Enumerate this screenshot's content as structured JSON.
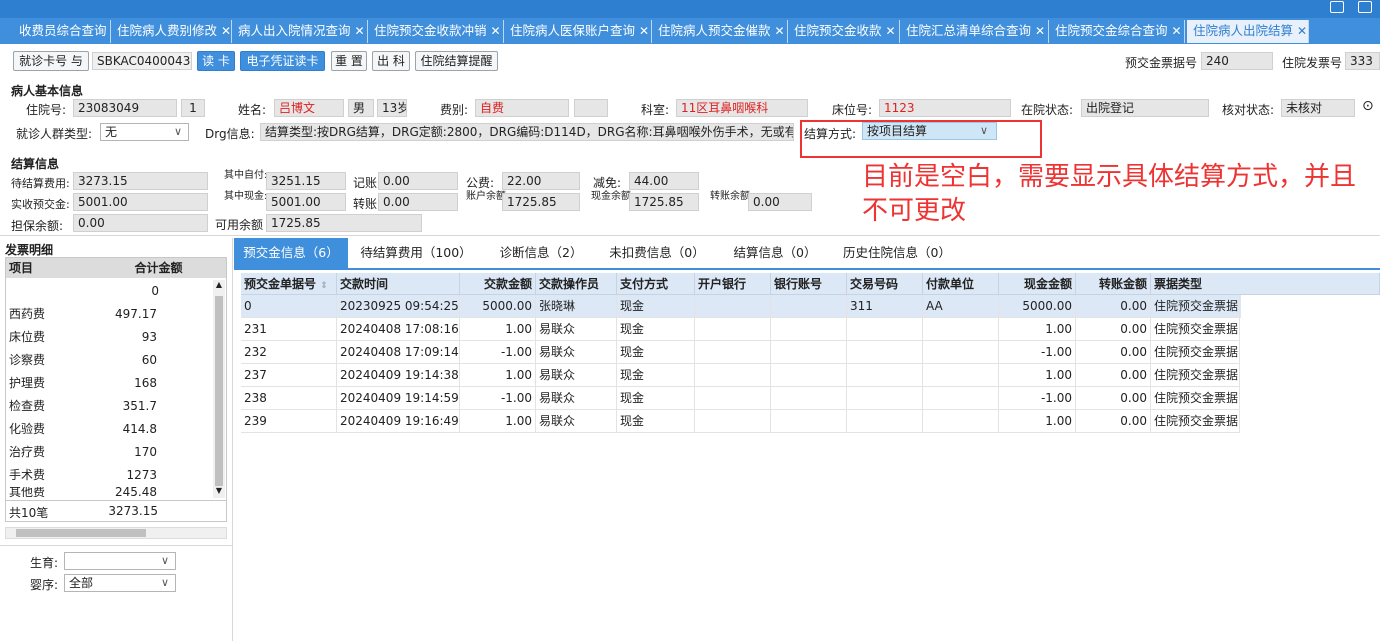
{
  "tabs": [
    {
      "label": "收费员综合查询"
    },
    {
      "label": "住院病人费别修改"
    },
    {
      "label": "病人出入院情况查询"
    },
    {
      "label": "住院预交金收款冲销"
    },
    {
      "label": "住院病人医保账户查询"
    },
    {
      "label": "住院病人预交金催款"
    },
    {
      "label": "住院预交金收款"
    },
    {
      "label": "住院汇总清单综合查询"
    },
    {
      "label": "住院预交金综合查询"
    },
    {
      "label": "住院病人出院结算"
    }
  ],
  "toolbar": {
    "visit_type": "就诊卡号",
    "visit_type_suffix": "与",
    "card_no": "SBKAC0400043",
    "read_card": "读 卡",
    "e_voucher": "电子凭证读卡",
    "reset": "重 置",
    "discharge": "出 科",
    "reminder": "住院结算提醒",
    "deposit_invoice_label": "预交金票据号",
    "deposit_invoice": "240",
    "invoice_label": "住院发票号",
    "invoice": "333"
  },
  "patient": {
    "section_title": "病人基本信息",
    "inpatient_no_label": "住院号:",
    "inpatient_no": "23083049",
    "times": "1",
    "name_label": "姓名:",
    "name": "吕博文",
    "gender": "男",
    "age": "13岁",
    "fee_type_label": "费别:",
    "fee_type": "自费",
    "dept_label": "科室:",
    "dept": "11区耳鼻咽喉科",
    "bed_label": "床位号:",
    "bed": "1123",
    "status_label": "在院状态:",
    "status": "出院登记",
    "check_label": "核对状态:",
    "check": "未核对",
    "group_label": "就诊人群类型:",
    "group": "无",
    "drg_label": "Drg信息:",
    "drg": "结算类型:按DRG结算，DRG定额:2800，DRG编码:D114D，DRG名称:耳鼻咽喉外伤手术，无或有轻微并",
    "settle_mode_label": "结算方式:",
    "settle_mode": "按项目结算"
  },
  "annotation": "目前是空白，需要显示具体结算方式，并且不可更改",
  "settle": {
    "section_title": "结算信息",
    "pending_label": "待结算费用:",
    "pending": "3273.15",
    "of_which_self_label": "其中自付:",
    "of_which_self": "3251.15",
    "charge_label": "记账",
    "charge": "0.00",
    "public_label": "公费:",
    "public": "22.00",
    "reduce_label": "减免:",
    "reduce": "44.00",
    "received_label": "实收预交金:",
    "received": "5001.00",
    "of_which_cash_label": "其中现金:",
    "of_which_cash": "5001.00",
    "transfer_label": "转账",
    "transfer": "0.00",
    "account_balance_label": "账户余额",
    "account_balance": "1725.85",
    "cash_balance_label": "现金余额",
    "cash_balance": "1725.85",
    "transfer_balance_label": "转账余额",
    "transfer_balance": "0.00",
    "guarantee_label": "担保余额:",
    "guarantee": "0.00",
    "available_label": "可用余额",
    "available": "1725.85"
  },
  "invoice_detail": {
    "title": "发票明细",
    "col_item": "项目",
    "col_amount": "合计金额",
    "rows": [
      {
        "item": "",
        "amount": "0"
      },
      {
        "item": "西药费",
        "amount": "497.17"
      },
      {
        "item": "床位费",
        "amount": "93"
      },
      {
        "item": "诊察费",
        "amount": "60"
      },
      {
        "item": "护理费",
        "amount": "168"
      },
      {
        "item": "检查费",
        "amount": "351.7"
      },
      {
        "item": "化验费",
        "amount": "414.8"
      },
      {
        "item": "治疗费",
        "amount": "170"
      },
      {
        "item": "手术费",
        "amount": "1273"
      },
      {
        "item": "其他费",
        "amount": "245.48"
      }
    ],
    "total_label": "共10笔",
    "total": "3273.15"
  },
  "filters": {
    "birth_label": "生育:",
    "birth": "",
    "order_label": "婴序:",
    "order": "全部"
  },
  "right_tabs": [
    {
      "label": "预交金信息（6）"
    },
    {
      "label": "待结算费用（100）"
    },
    {
      "label": "诊断信息（2）"
    },
    {
      "label": "未扣费信息（0）"
    },
    {
      "label": "结算信息（0）"
    },
    {
      "label": "历史住院信息（0）"
    }
  ],
  "table": {
    "headers": [
      "预交金单据号",
      "交款时间",
      "交款金额",
      "交款操作员",
      "支付方式",
      "开户银行",
      "银行账号",
      "交易号码",
      "付款单位",
      "现金金额",
      "转账金额",
      "票据类型"
    ],
    "rows": [
      [
        "0",
        "20230925 09:54:25",
        "5000.00",
        "张晓琳",
        "现金",
        "",
        "",
        "311",
        "AA",
        "5000.00",
        "0.00",
        "住院预交金票据"
      ],
      [
        "231",
        "20240408 17:08:16",
        "1.00",
        "易联众",
        "现金",
        "",
        "",
        "",
        "",
        "1.00",
        "0.00",
        "住院预交金票据"
      ],
      [
        "232",
        "20240408 17:09:14",
        "-1.00",
        "易联众",
        "现金",
        "",
        "",
        "",
        "",
        "-1.00",
        "0.00",
        "住院预交金票据"
      ],
      [
        "237",
        "20240409 19:14:38",
        "1.00",
        "易联众",
        "现金",
        "",
        "",
        "",
        "",
        "1.00",
        "0.00",
        "住院预交金票据"
      ],
      [
        "238",
        "20240409 19:14:59",
        "-1.00",
        "易联众",
        "现金",
        "",
        "",
        "",
        "",
        "-1.00",
        "0.00",
        "住院预交金票据"
      ],
      [
        "239",
        "20240409 19:16:49",
        "1.00",
        "易联众",
        "现金",
        "",
        "",
        "",
        "",
        "1.00",
        "0.00",
        "住院预交金票据"
      ]
    ]
  }
}
